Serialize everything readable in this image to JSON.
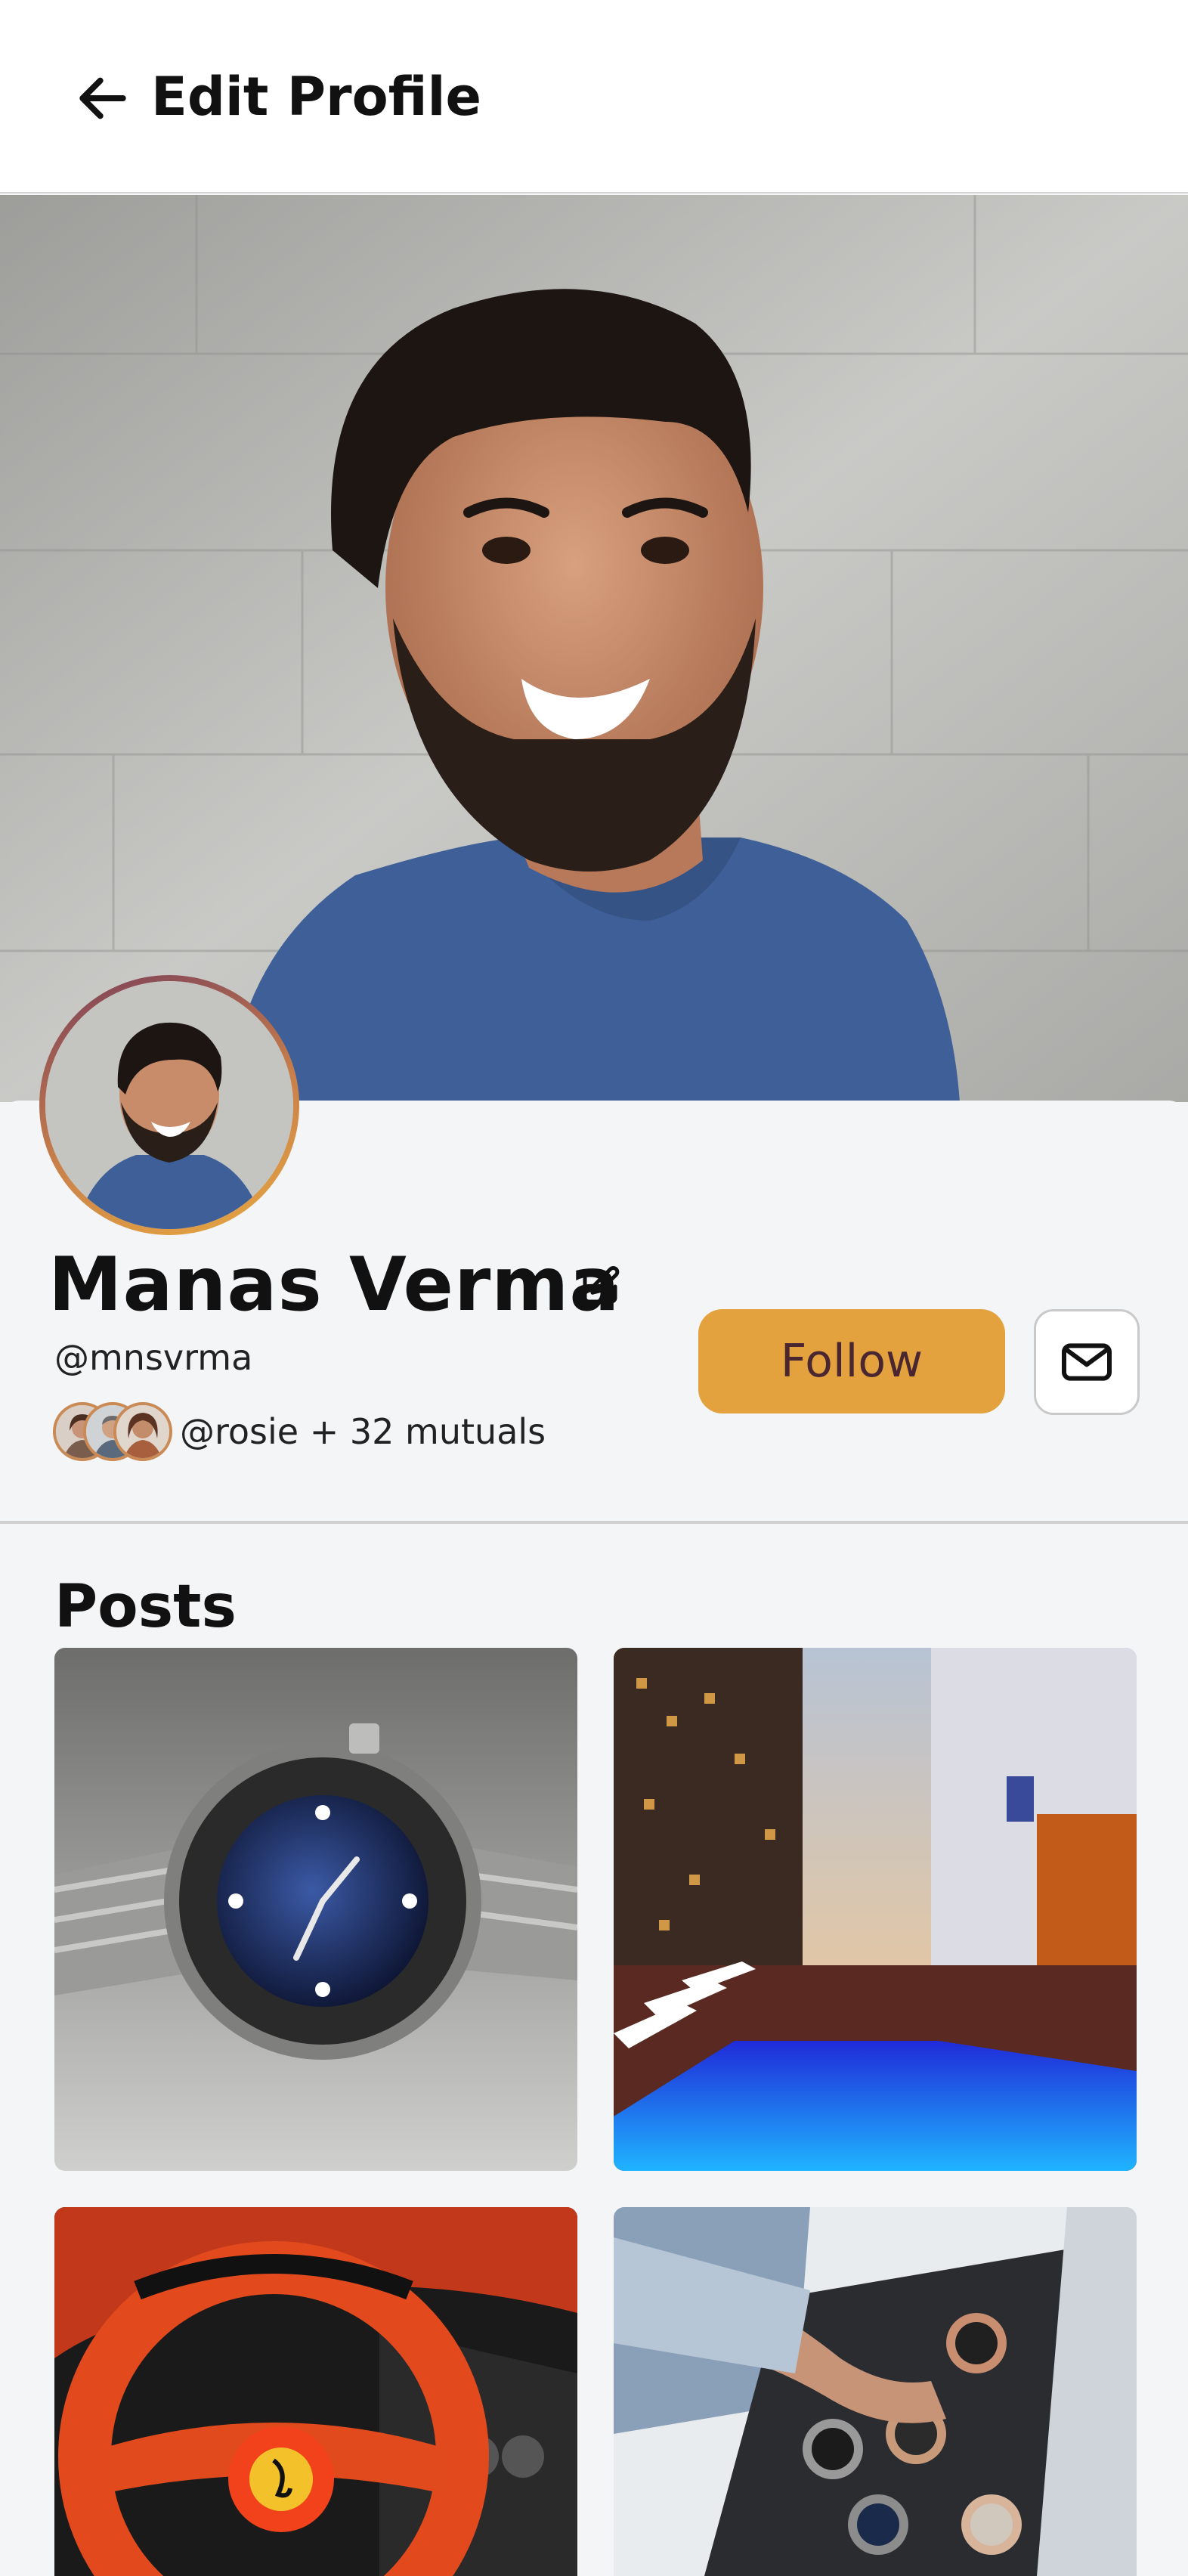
{
  "header": {
    "back_icon": "arrow-left-icon",
    "title": "Edit Profile"
  },
  "cover": {
    "alt": "cover-photo-smiling-man"
  },
  "profile": {
    "name": "Manas Verma",
    "edit_icon": "pencil-edit-icon",
    "handle": "@mnsvrma",
    "mutuals_text": "@rosie + 32 mutuals",
    "follow_label": "Follow",
    "message_icon": "envelope-icon"
  },
  "posts": {
    "title": "Posts",
    "items": [
      {
        "subject": "dive-watch-photo"
      },
      {
        "subject": "rooftop-pool-photo"
      },
      {
        "subject": "sports-car-steering-wheel-photo"
      },
      {
        "subject": "watch-collection-box-photo"
      }
    ]
  },
  "colors": {
    "accent": "#e4a23f",
    "follow_text": "#4a2630",
    "background": "#f4f5f7",
    "avatar_ring": "#c9804a"
  }
}
